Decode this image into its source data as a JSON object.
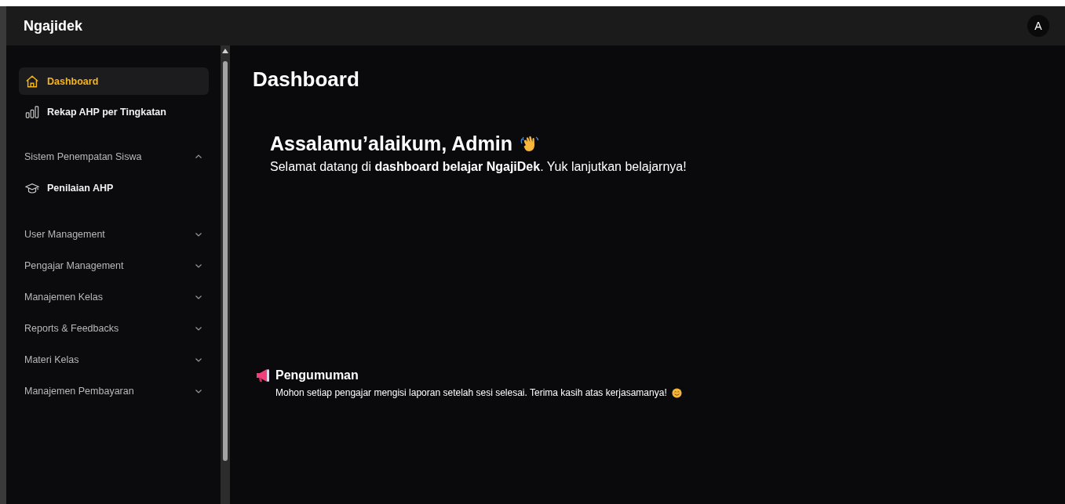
{
  "app": {
    "title": "Ngajidek",
    "avatar": "A"
  },
  "sidebar": {
    "items": [
      {
        "label": "Dashboard",
        "kind": "home",
        "selected": true
      },
      {
        "label": "Rekap AHP per Tingkatan",
        "kind": "chart",
        "selected": false
      }
    ],
    "groups": [
      {
        "label": "Sistem Penempatan Siswa",
        "expanded": true,
        "children": [
          {
            "label": "Penilaian AHP",
            "kind": "assessment",
            "selected": false
          }
        ]
      },
      {
        "label": "User Management",
        "expanded": false
      },
      {
        "label": "Pengajar Management",
        "expanded": false
      },
      {
        "label": "Manajemen Kelas",
        "expanded": false
      },
      {
        "label": "Reports & Feedbacks",
        "expanded": false
      },
      {
        "label": "Materi Kelas",
        "expanded": false
      },
      {
        "label": "Manajemen Pembayaran",
        "expanded": false
      }
    ]
  },
  "page": {
    "title": "Dashboard",
    "greeting": "Assalamu’alaikum, Admin",
    "subtitle": "Selamat datang di **dashboard belajar NgajiDek**. Yuk lanjutkan belajarnya!",
    "announcement": {
      "title": "Pengumuman",
      "text": "Mohon setiap pengajar mengisi laporan setelah sesi selesai. Terima kasih atas kerjasamanya!"
    }
  }
}
